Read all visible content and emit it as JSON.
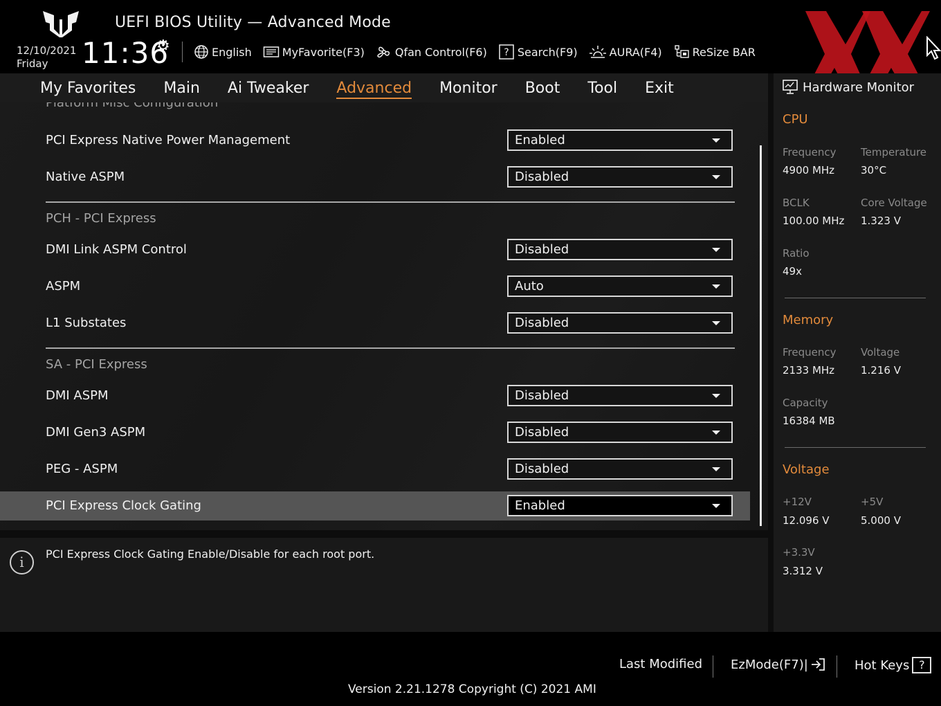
{
  "header": {
    "title": "UEFI BIOS Utility — Advanced Mode",
    "date": "12/10/2021",
    "day": "Friday",
    "time": "11:36",
    "toolbar": [
      {
        "label": "English",
        "icon": "globe-icon"
      },
      {
        "label": "MyFavorite(F3)",
        "icon": "favorite-list-icon"
      },
      {
        "label": "Qfan Control(F6)",
        "icon": "fan-icon"
      },
      {
        "label": "Search(F9)",
        "icon": "search-help-icon"
      },
      {
        "label": "AURA(F4)",
        "icon": "aura-light-icon"
      },
      {
        "label": "ReSize BAR",
        "icon": "resize-bar-icon"
      }
    ]
  },
  "tabs": [
    {
      "label": "My Favorites"
    },
    {
      "label": "Main"
    },
    {
      "label": "Ai Tweaker"
    },
    {
      "label": "Advanced",
      "active": true
    },
    {
      "label": "Monitor"
    },
    {
      "label": "Boot"
    },
    {
      "label": "Tool"
    },
    {
      "label": "Exit"
    }
  ],
  "main": {
    "cut_title": "Platform Misc Configuration",
    "rows": [
      {
        "label": "PCI Express Native Power Management",
        "value": "Enabled"
      },
      {
        "label": "Native ASPM",
        "value": "Disabled"
      },
      {
        "label": "DMI Link ASPM Control",
        "value": "Disabled"
      },
      {
        "label": "ASPM",
        "value": "Auto"
      },
      {
        "label": "L1 Substates",
        "value": "Disabled"
      },
      {
        "label": "DMI ASPM",
        "value": "Disabled"
      },
      {
        "label": "DMI Gen3 ASPM",
        "value": "Disabled"
      },
      {
        "label": "PEG - ASPM",
        "value": "Disabled"
      },
      {
        "label": "PCI Express Clock Gating",
        "value": "Enabled",
        "selected": true
      }
    ],
    "sections": [
      "PCH - PCI Express",
      "SA - PCI Express"
    ]
  },
  "help": {
    "text": "PCI Express Clock Gating Enable/Disable for each root port."
  },
  "hw_monitor": {
    "title": "Hardware Monitor",
    "cpu": {
      "heading": "CPU",
      "frequency_label": "Frequency",
      "frequency": "4900 MHz",
      "temperature_label": "Temperature",
      "temperature": "30°C",
      "bclk_label": "BCLK",
      "bclk": "100.00 MHz",
      "core_voltage_label": "Core Voltage",
      "core_voltage": "1.323 V",
      "ratio_label": "Ratio",
      "ratio": "49x"
    },
    "memory": {
      "heading": "Memory",
      "frequency_label": "Frequency",
      "frequency": "2133 MHz",
      "voltage_label": "Voltage",
      "voltage": "1.216 V",
      "capacity_label": "Capacity",
      "capacity": "16384 MB"
    },
    "voltage": {
      "heading": "Voltage",
      "v12_label": "+12V",
      "v12": "12.096 V",
      "v5_label": "+5V",
      "v5": "5.000 V",
      "v33_label": "+3.3V",
      "v33": "3.312 V"
    }
  },
  "footer": {
    "last_modified": "Last Modified",
    "ezmode": "EzMode(F7)|",
    "hot_keys": "Hot Keys",
    "hot_keys_icon": "?",
    "version": "Version 2.21.1278 Copyright (C) 2021 AMI"
  },
  "colors": {
    "accent": "#e28a3b",
    "watermark": "#c0141c"
  }
}
